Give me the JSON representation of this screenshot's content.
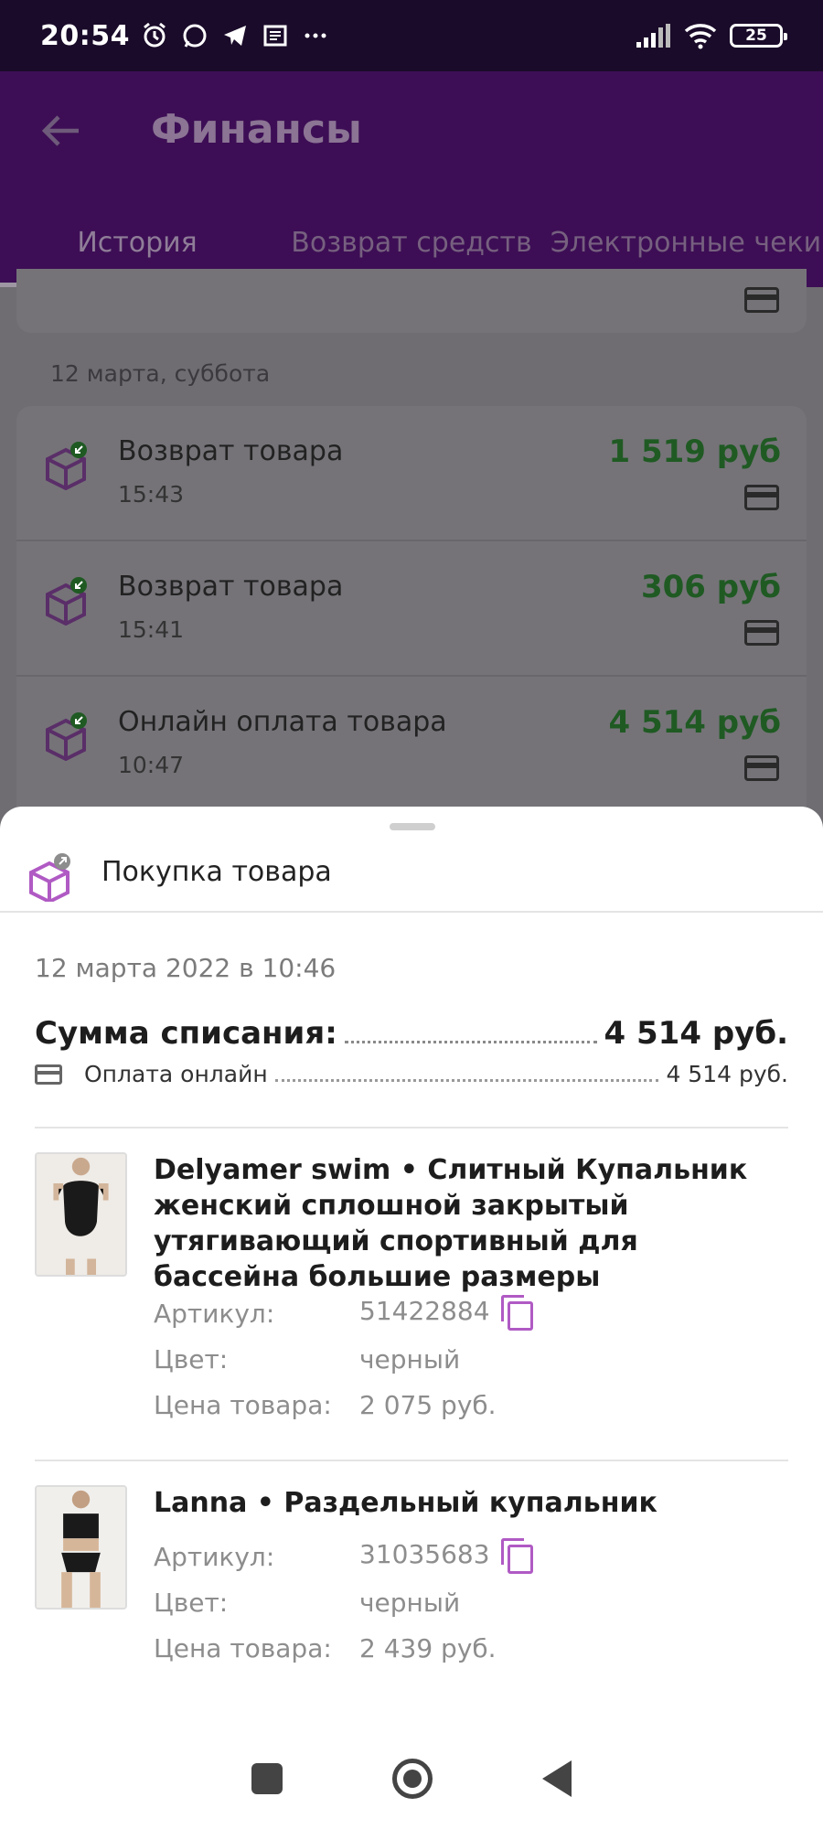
{
  "status_bar": {
    "time": "20:54",
    "icons": [
      "alarm-icon",
      "whatsapp-icon",
      "telegram-icon",
      "news-icon",
      "more-icon"
    ],
    "right_icons": [
      "signal-icon",
      "wifi-icon"
    ],
    "battery": "25"
  },
  "header": {
    "title": "Финансы",
    "back_icon": "arrow-left-icon"
  },
  "tabs": [
    {
      "label": "История",
      "active": true
    },
    {
      "label": "Возврат средств",
      "active": false
    },
    {
      "label": "Электронные чеки",
      "active": false
    }
  ],
  "history": {
    "section_label": "12 марта, суббота",
    "items": [
      {
        "title": "Возврат товара",
        "time": "15:43",
        "amount": "1 519 руб"
      },
      {
        "title": "Возврат товара",
        "time": "15:41",
        "amount": "306 руб"
      },
      {
        "title": "Онлайн оплата товара",
        "time": "10:47",
        "amount": "4 514 руб"
      }
    ],
    "colors": {
      "amount": "#1f5a23",
      "overlay": "#6f6d71"
    }
  },
  "sheet": {
    "title": "Покупка товара",
    "date": "12 марта 2022 в 10:46",
    "sum_label": "Сумма списания:",
    "sum_value": "4 514 руб.",
    "payment_label": "Оплата онлайн",
    "payment_value": "4 514 руб.",
    "products": [
      {
        "name": "Delyamer swim • Слитный Купальник женский сплошной закрытый утягивающий спортивный для бассейна большие размеры",
        "article_label": "Артикул:",
        "article": "51422884",
        "color_label": "Цвет:",
        "color": "черный",
        "price_label": "Цена товара:",
        "price": "2 075 руб."
      },
      {
        "name": "Lanna • Раздельный купальник",
        "article_label": "Артикул:",
        "article": "31035683",
        "color_label": "Цвет:",
        "color": "черный",
        "price_label": "Цена товара:",
        "price": "2 439 руб."
      }
    ],
    "accent_color": "#b05ac4"
  },
  "navbar": {
    "icons": [
      "recents-square-icon",
      "home-circle-icon",
      "back-triangle-icon"
    ]
  }
}
